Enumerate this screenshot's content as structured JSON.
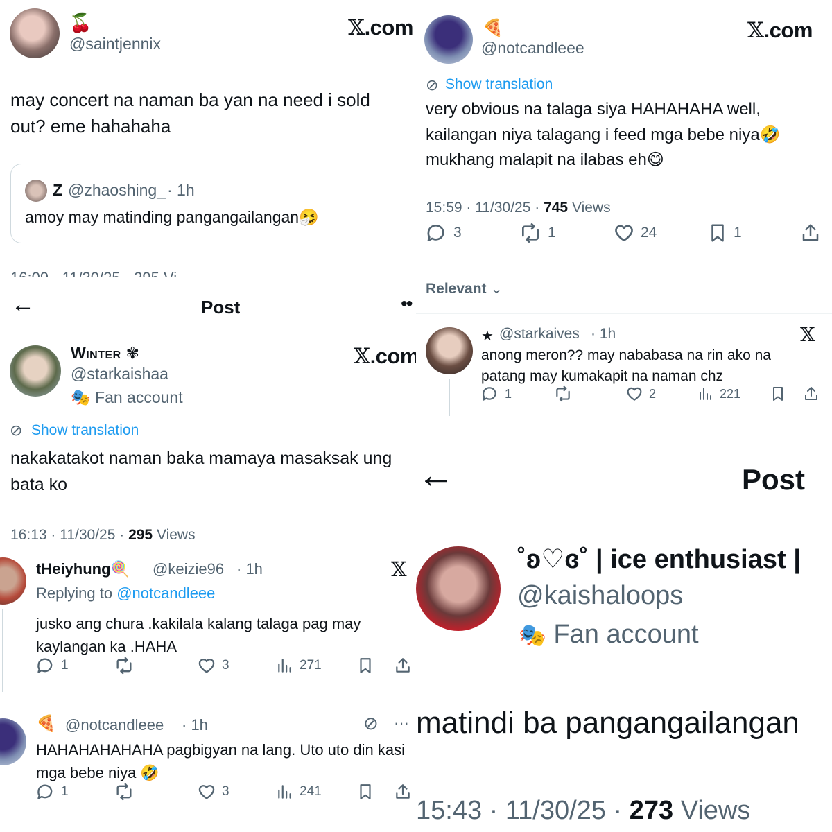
{
  "p1": {
    "emoji": "🍒",
    "handle": "@saintjennix",
    "site": "X.com",
    "text": "may concert na naman ba yan na need i sold out? eme hahahaha",
    "quote": {
      "name": "Z",
      "handle": "@zhaoshing_",
      "time": "· 1h",
      "text": "amoy may matinding pangangailangan🤧"
    },
    "cut_meta": "16:09 · 11/30/25 · 295 Vi"
  },
  "p2": {
    "emoji": "🍕",
    "handle": "@notcandleee",
    "site": "X.com",
    "translate": "Show translation",
    "text_lines": [
      "very obvious na talaga siya HAHAHAHA well,",
      "kailangan niya talagang i feed mga bebe niya🤣",
      "mukhang malapit na ilabas eh😋"
    ],
    "meta_time": "15:59 · 11/30/25 · ",
    "meta_views": "745",
    "meta_views_label": " Views",
    "replies": "3",
    "reposts": "1",
    "likes": "24",
    "bookmarks": "1",
    "sort": "Relevant",
    "reply": {
      "star": "★",
      "handle": "@starkaives",
      "time": "· 1h",
      "text_lines": [
        "anong meron?? may nababasa na rin ako na",
        "patang may kumakapit na naman chz"
      ],
      "replies": "1",
      "likes": "2",
      "views": "221"
    }
  },
  "p3": {
    "header": "Post",
    "name": "Winter",
    "name_symbol": "✾",
    "handle": "@starkaishaa",
    "badge": "Fan account",
    "site": "X.com",
    "translate": "Show translation",
    "text": "nakakatakot naman baka mamaya masaksak ung bata ko",
    "meta_time": "16:13 · 11/30/25 · ",
    "meta_views": "295",
    "meta_views_label": " Views",
    "reply1": {
      "name": "tHeiyhung🍭",
      "handle": "@keizie96",
      "time": "· 1h",
      "replying_label": "Replying to ",
      "replying_to": "@notcandleee",
      "text": "jusko ang chura .kakilala kalang talaga pag may kaylangan ka .HAHA",
      "replies": "1",
      "likes": "3",
      "views": "271"
    },
    "reply2": {
      "emoji": "🍕",
      "handle": "@notcandleee",
      "time": "· 1h",
      "text": "HAHAHAHAHAHA pagbigyan na lang. Uto uto din kasi mga bebe niya 🤣",
      "replies": "1",
      "likes": "3",
      "views": "241"
    }
  },
  "p4": {
    "header": "Post",
    "name": "˚ʚ♡ɞ˚ | ice enthusiast |",
    "handle": "@kaishaloops",
    "badge": "Fan account",
    "text": "matindi ba pangangailangan",
    "meta_time": "15:43 · 11/30/25 · ",
    "meta_views": "273",
    "meta_views_label": " Views"
  },
  "colors": {
    "text": "#0f1419",
    "gray": "#536471",
    "link": "#1d9bf0",
    "border": "#eff3f4"
  },
  "icons": [
    "reply-icon",
    "repost-icon",
    "like-icon",
    "views-icon",
    "bookmark-icon",
    "share-icon",
    "x-logo-icon",
    "back-arrow-icon",
    "translate-icon",
    "fan-account-icon",
    "more-icon",
    "chevron-down-icon"
  ]
}
